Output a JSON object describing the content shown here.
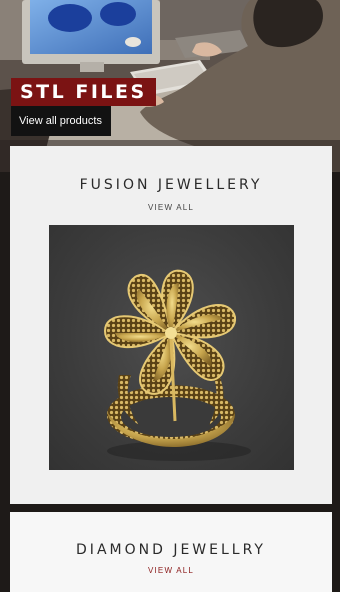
{
  "hero": {
    "tag_label": "STL FILES",
    "link_label": "View all products"
  },
  "categories": [
    {
      "title": "FUSION JEWELLERY",
      "view_all": "VIEW ALL"
    },
    {
      "title": "DIAMOND JEWELLRY",
      "view_all": "VIEW ALL"
    }
  ],
  "colors": {
    "accent": "#7b1313",
    "card_background": "#f0f0f0",
    "product_background": "#3c3c3c",
    "gold": "#c8a64e"
  }
}
